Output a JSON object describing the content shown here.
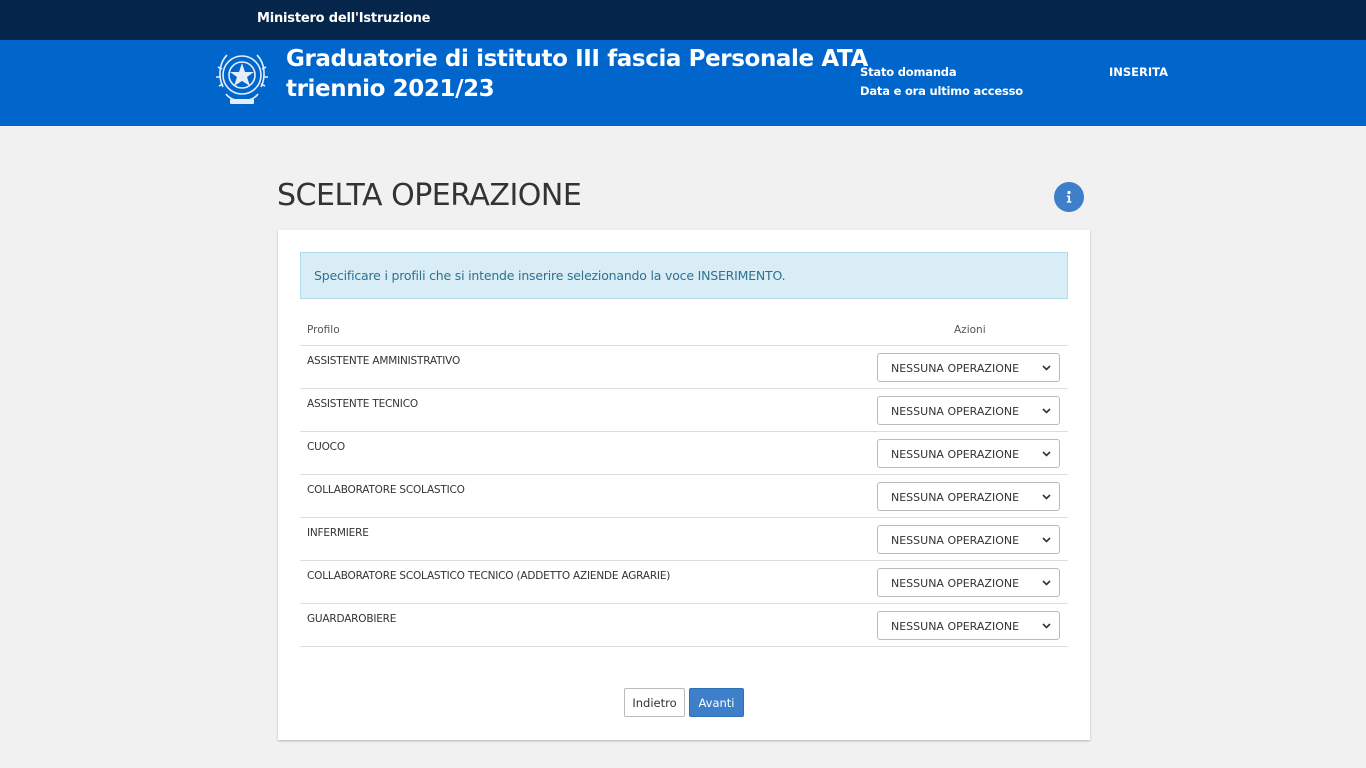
{
  "topbar": {
    "ministry": "Ministero dell'Istruzione"
  },
  "header": {
    "title_line1": "Graduatorie di istituto III fascia Personale ATA",
    "title_line2": "triennio 2021/23",
    "status_label": "Stato domanda",
    "access_label": "Data e ora ultimo accesso",
    "status_value": "INSERITA",
    "emblem_icon": "italian-republic-emblem-icon"
  },
  "page": {
    "title": "SCELTA OPERAZIONE",
    "info_icon": "info-icon"
  },
  "alert": {
    "text": "Specificare i profili che si intende inserire selezionando la voce INSERIMENTO."
  },
  "table": {
    "headers": {
      "profile": "Profilo",
      "actions": "Azioni"
    },
    "rows": [
      {
        "profile": "ASSISTENTE AMMINISTRATIVO",
        "action": "NESSUNA OPERAZIONE"
      },
      {
        "profile": "ASSISTENTE TECNICO",
        "action": "NESSUNA OPERAZIONE"
      },
      {
        "profile": "CUOCO",
        "action": "NESSUNA OPERAZIONE"
      },
      {
        "profile": "COLLABORATORE SCOLASTICO",
        "action": "NESSUNA OPERAZIONE"
      },
      {
        "profile": "INFERMIERE",
        "action": "NESSUNA OPERAZIONE"
      },
      {
        "profile": "COLLABORATORE SCOLASTICO TECNICO (ADDETTO AZIENDE AGRARIE)",
        "action": "NESSUNA OPERAZIONE"
      },
      {
        "profile": "GUARDAROBIERE",
        "action": "NESSUNA OPERAZIONE"
      }
    ]
  },
  "buttons": {
    "back": "Indietro",
    "next": "Avanti"
  },
  "colors": {
    "topbar": "#05254a",
    "header": "#0066cc",
    "primary_button": "#3d7fc9",
    "alert_bg": "#d9edf7"
  }
}
